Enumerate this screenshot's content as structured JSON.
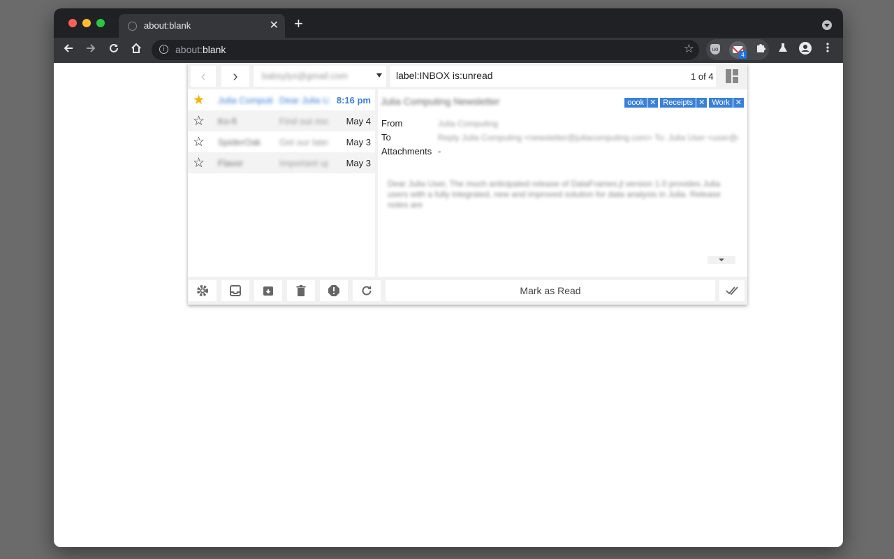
{
  "browser": {
    "tab_title": "about:blank",
    "tab_close": "✕",
    "new_tab": "+",
    "url_scheme": "about:",
    "url_rest": "blank",
    "extension_badge": "4"
  },
  "popup": {
    "account": "babsylys@gmail.com",
    "query": "label:INBOX is:unread",
    "counter": "1 of 4",
    "prev_label": "‹",
    "next_label": "›",
    "messages": [
      {
        "from": "Julia Computing",
        "snippet": "Dear Julia User",
        "date": "8:16 pm",
        "starred": true,
        "selected": true
      },
      {
        "from": "Ko-fi",
        "snippet": "Find out more",
        "date": "May 4",
        "starred": false,
        "selected": false
      },
      {
        "from": "SpiderOak",
        "snippet": "Get our latest",
        "date": "May 3",
        "starred": false,
        "selected": false
      },
      {
        "from": "Flavor",
        "snippet": "Important update",
        "date": "May 3",
        "starred": false,
        "selected": false
      }
    ],
    "preview": {
      "subject": "Julia Computing Newsletter",
      "labels": [
        "oook",
        "Receipts",
        "Work"
      ],
      "label_close": "✕",
      "from_label": "From",
      "from_value": "Julia Computing",
      "to_label": "To",
      "to_value": "Reply Julia Computing <newsletter@juliacomputing.com> To: Julia User <user@example.com>",
      "attachments_label": "Attachments",
      "attachments_value": "-",
      "body": "Dear Julia User, The much anticipated release of DataFrames.jl version 1.0 provides Julia users with a fully integrated, new and improved solution for data analysis in Julia. Release notes are"
    },
    "mark_read_label": "Mark as Read"
  },
  "colors": {
    "accent": "#1a73e8",
    "label_bg": "#3a80db",
    "star": "#f4b400",
    "selected_text": "#3a80db"
  }
}
